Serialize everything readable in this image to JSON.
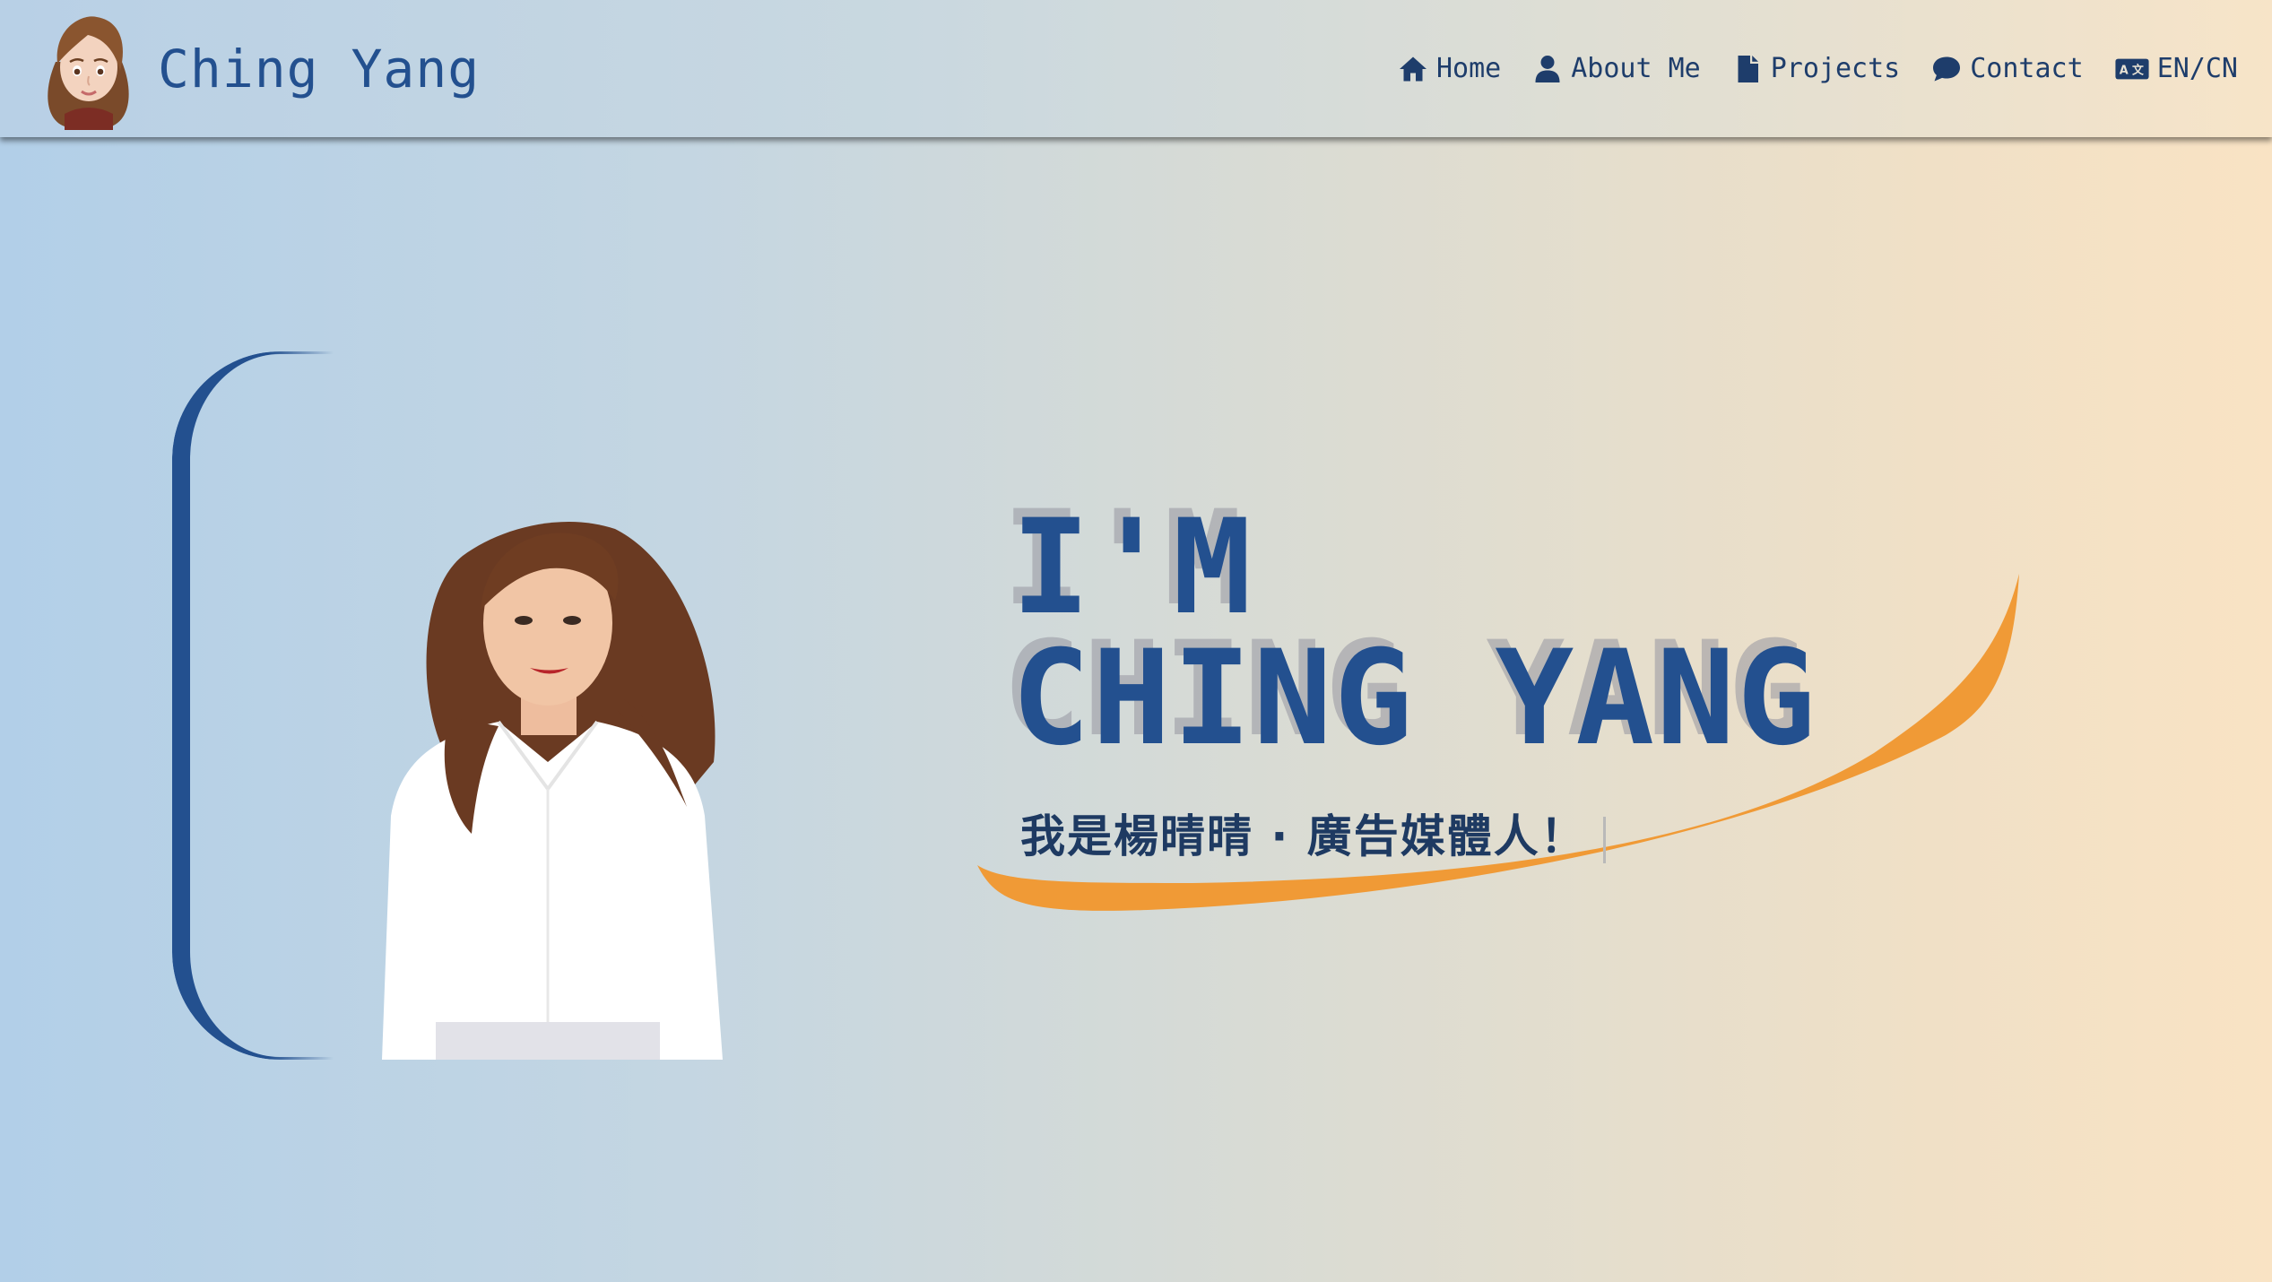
{
  "brand": {
    "name": "Ching Yang",
    "avatar_icon": "memoji-avatar"
  },
  "nav": {
    "items": [
      {
        "label": "Home",
        "icon": "home-icon"
      },
      {
        "label": "About Me",
        "icon": "user-icon"
      },
      {
        "label": "Projects",
        "icon": "file-icon"
      },
      {
        "label": "Contact",
        "icon": "chat-icon"
      },
      {
        "label": "EN/CN",
        "icon": "language-icon"
      }
    ]
  },
  "hero": {
    "line1": "I'M",
    "line2": "CHING YANG",
    "subtitle": "我是楊晴晴 · 廣告媒體人！"
  },
  "colors": {
    "primary": "#23508f",
    "accent_swoosh": "#f09a36",
    "text_dark": "#1e3d6b"
  }
}
